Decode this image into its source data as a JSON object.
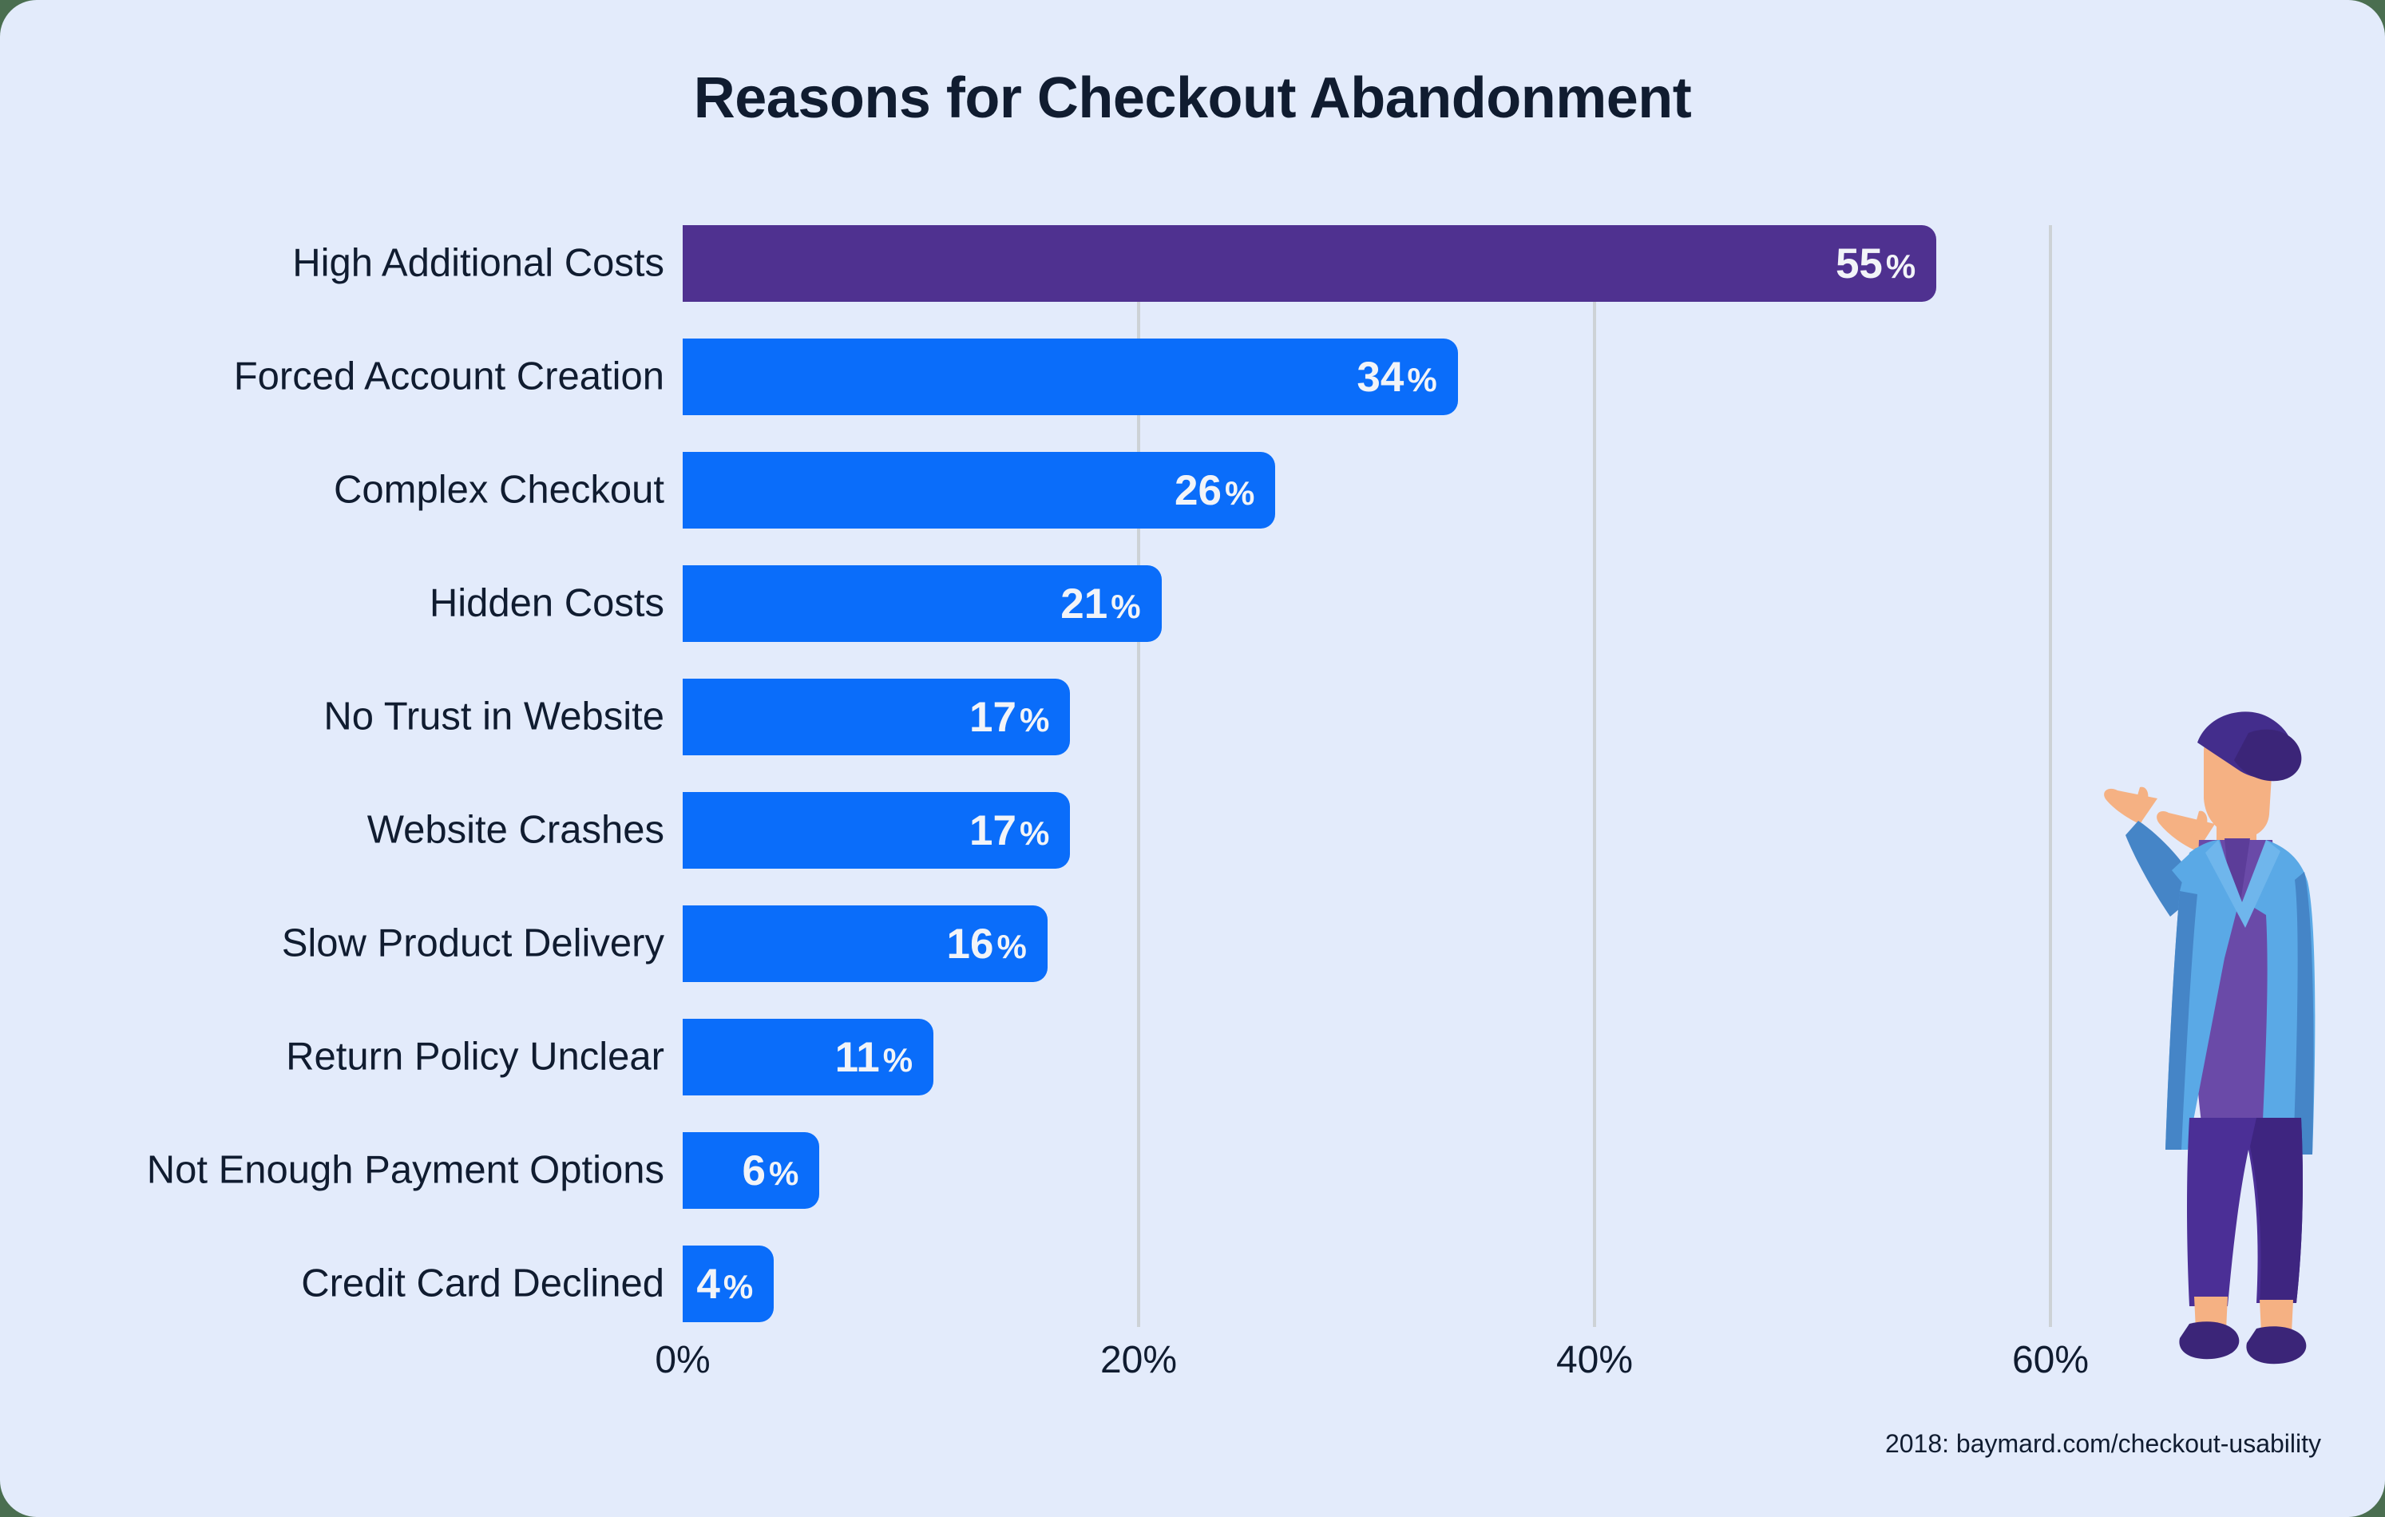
{
  "card": {
    "background_color": "#e3ebfb",
    "outer_background_color": "#4a6e50"
  },
  "header": {
    "title": "Reasons for Checkout Abandonment"
  },
  "footer": {
    "source": "2018: baymard.com/checkout-usability"
  },
  "illustration": {
    "name": "standing-person-gesturing",
    "skin_color": "#f5b183",
    "hat_color": "#432d8c",
    "jacket_color": "#5aa9e6",
    "jacket_shadow_color": "#4585c7",
    "shirt_color": "#6a4aa8",
    "pants_color": "#4b2f96",
    "pants_shadow_color": "#3e2580",
    "shoe_color": "#3b2578"
  },
  "chart_data": {
    "type": "bar",
    "orientation": "horizontal",
    "title": "Reasons for Checkout Abandonment",
    "xlabel": "",
    "ylabel": "",
    "xlim": [
      0,
      63
    ],
    "grid": true,
    "grid_axis": "x",
    "legend": false,
    "value_suffix": "%",
    "bar_color": "#0a6dfa",
    "highlight_color": "#4f3190",
    "text_color": "#101c30",
    "value_label_color": "#f2f4f8",
    "gridline_color": "#cdd2d6",
    "xticks": [
      0,
      20,
      40,
      60
    ],
    "xtick_labels": [
      "0%",
      "20%",
      "40%",
      "60%"
    ],
    "categories": [
      "High Additional Costs",
      "Forced Account Creation",
      "Complex Checkout",
      "Hidden Costs",
      "No Trust in Website",
      "Website Crashes",
      "Slow Product Delivery",
      "Return Policy Unclear",
      "Not Enough Payment Options",
      "Credit Card Declined"
    ],
    "values": [
      55,
      34,
      26,
      21,
      17,
      17,
      16,
      11,
      6,
      4
    ],
    "value_labels": [
      "55",
      "34",
      "26",
      "21",
      "17",
      "17",
      "16",
      "11",
      "6",
      "4"
    ],
    "highlighted_index": 0
  }
}
